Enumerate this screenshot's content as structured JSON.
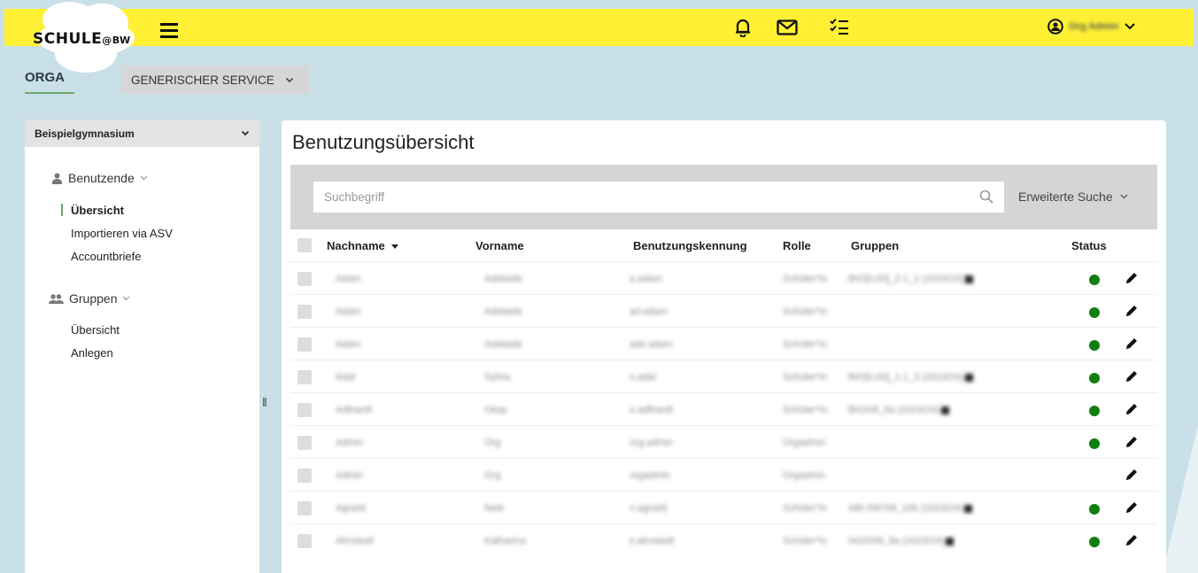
{
  "header": {
    "logo_main": "SCHULE",
    "logo_suffix": "@BW",
    "user_name": "Org Admin"
  },
  "tabs": {
    "orga": "ORGA",
    "service_dropdown": "GENERISCHER SERVICE"
  },
  "sidebar": {
    "school": "Beispielgymnasium",
    "sections": [
      {
        "label": "Benutzende",
        "items": [
          "Übersicht",
          "Importieren via ASV",
          "Accountbriefe"
        ]
      },
      {
        "label": "Gruppen",
        "items": [
          "Übersicht",
          "Anlegen"
        ]
      }
    ]
  },
  "main": {
    "title": "Benutzungsübersicht",
    "search_placeholder": "Suchbegriff",
    "advanced_search": "Erweiterte Suche",
    "columns": [
      "Nachname",
      "Vorname",
      "Benutzungskennung",
      "Rolle",
      "Gruppen",
      "Status"
    ],
    "rows": [
      {
        "nachname": "Adam",
        "vorname": "Adelaide",
        "kennung": "a.adam",
        "rolle": "Schüler*in",
        "gruppen": "BIO[0,00]_2.1_1 (2023/24)",
        "status_active": true
      },
      {
        "nachname": "Adam",
        "vorname": "Adelaide",
        "kennung": "ad.adam",
        "rolle": "Schüler*in",
        "gruppen": "",
        "status_active": true
      },
      {
        "nachname": "Adam",
        "vorname": "Adelaide",
        "kennung": "ade.adam",
        "rolle": "Schüler*in",
        "gruppen": "",
        "status_active": true
      },
      {
        "nachname": "Adal",
        "vorname": "Sylvia",
        "kennung": "s.adal",
        "rolle": "Schüler*in",
        "gruppen": "BIO[0,00]_1.1_3 (2023/24)",
        "status_active": true
      },
      {
        "nachname": "Adlhardt",
        "vorname": "Okay",
        "kennung": "o.adlhardt",
        "rolle": "Schüler*in",
        "gruppen": "BIO/08_8a (2023/24)",
        "status_active": true
      },
      {
        "nachname": "Admin",
        "vorname": "Org",
        "kennung": "org.admin",
        "rolle": "Orgadmin",
        "gruppen": "",
        "status_active": true
      },
      {
        "nachname": "Admin",
        "vorname": "Org",
        "kennung": "orgadmin",
        "rolle": "Orgadmin",
        "gruppen": "",
        "status_active": false
      },
      {
        "nachname": "Agnetti",
        "vorname": "Nele",
        "kennung": "n.agnetti",
        "rolle": "Schüler*in",
        "gruppen": "ABI-INF/08_10b (2023/24)",
        "status_active": true
      },
      {
        "nachname": "Almstedt",
        "vorname": "Katharina",
        "kennung": "k.almstedt",
        "rolle": "Schüler*in",
        "gruppen": "9420/08_8a (2023/24)",
        "status_active": true
      }
    ]
  },
  "colors": {
    "header_bg": "#fff034",
    "page_bg": "#c9e0e8",
    "active_green": "#0f7f0f",
    "accent_green": "#6aaa6a"
  }
}
